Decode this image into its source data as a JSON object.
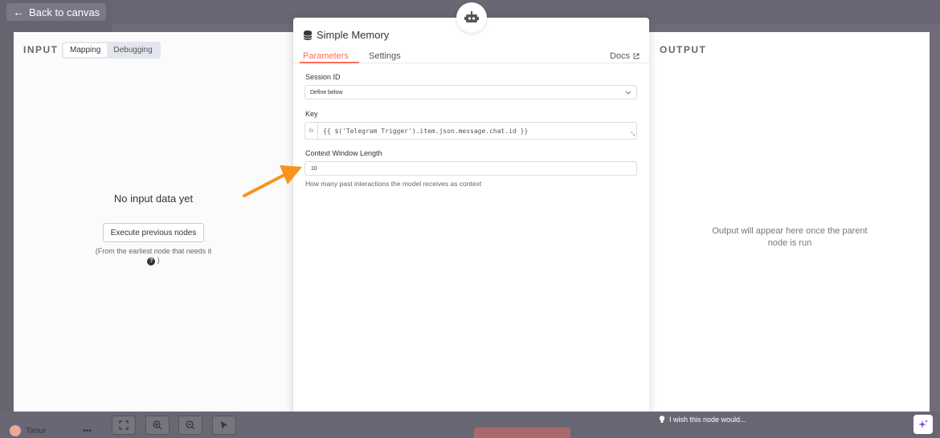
{
  "topbar": {
    "back_label": "Back to canvas"
  },
  "input_pane": {
    "title": "INPUT",
    "modes": [
      "Mapping",
      "Debugging"
    ],
    "active_mode": "Mapping",
    "empty_title": "No input data yet",
    "execute_label": "Execute previous nodes",
    "hint": "(From the earliest node that needs it",
    "hint_end": ")"
  },
  "output_pane": {
    "title": "OUTPUT",
    "message": "Output will appear here once the parent node is run"
  },
  "node": {
    "title": "Simple Memory",
    "tabs": [
      "Parameters",
      "Settings"
    ],
    "active_tab": "Parameters",
    "docs_label": "Docs",
    "fields": {
      "session_id_label": "Session ID",
      "session_id_value": "Define below",
      "key_label": "Key",
      "key_value": "{{ $('Telegram Trigger').item.json.message.chat.id }}",
      "key_fx": "fx",
      "context_label": "Context Window Length",
      "context_value": "10",
      "context_help": "How many past interactions the model receives as context"
    }
  },
  "bottom": {
    "user_name": "Timur",
    "wish_label": "I wish this node would..."
  },
  "colors": {
    "accent": "#ff6d5a",
    "annotation": "#f7941d"
  }
}
